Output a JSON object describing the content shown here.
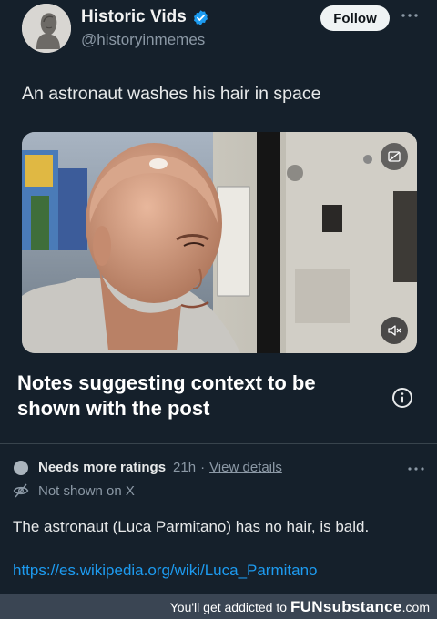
{
  "tweet": {
    "author_name": "Historic Vids",
    "author_handle": "@historyinmemes",
    "follow_label": "Follow",
    "text": "An astronaut washes his hair in space"
  },
  "media": {
    "type": "video",
    "top_icon": "image-fit-icon",
    "mute_icon": "speaker-muted-icon"
  },
  "community_notes": {
    "heading": "Notes suggesting context to be shown with the post",
    "note": {
      "status": "Needs more ratings",
      "time": "21h",
      "separator": "·",
      "view_details": "View details",
      "visibility": "Not shown on X",
      "body": "The astronaut (Luca Parmitano) has no hair, is bald.",
      "link": "https://es.wikipedia.org/wiki/Luca_Parmitano"
    }
  },
  "footer": {
    "tagline": "You'll get addicted to",
    "brand_bold": "FUN",
    "brand_rest": "substance",
    "brand_suffix": ".com"
  },
  "colors": {
    "background": "#15202b",
    "link": "#1d9bf0",
    "verified": "#1d9bf0",
    "muted_text": "#8b98a5"
  }
}
